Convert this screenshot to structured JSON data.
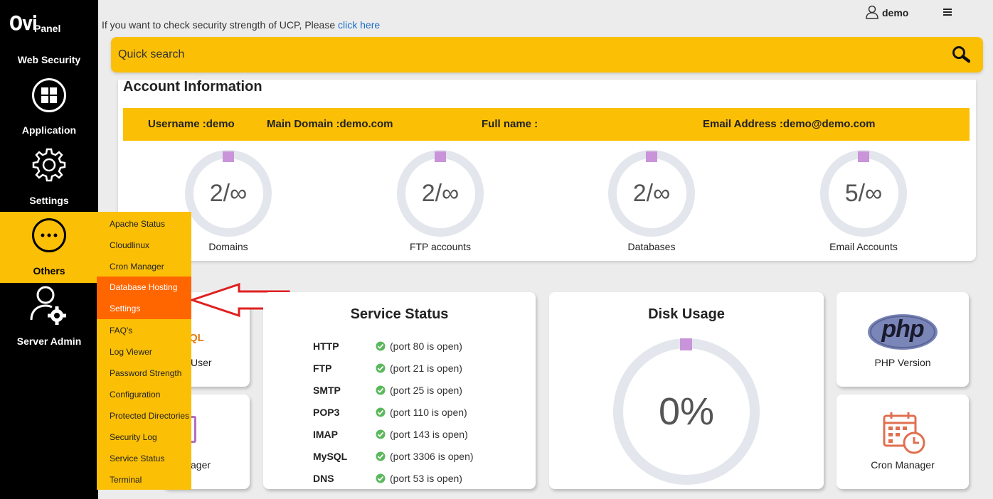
{
  "brand": {
    "logo_big": "Ovi",
    "logo_small": "Panel"
  },
  "sidebar": {
    "items": [
      {
        "label": "Web Security",
        "icon": "shield-icon"
      },
      {
        "label": "Application",
        "icon": "grid-icon"
      },
      {
        "label": "Settings",
        "icon": "gear-icon"
      },
      {
        "label": "Others",
        "icon": "more-icon"
      },
      {
        "label": "Server Admin",
        "icon": "user-gear-icon"
      }
    ]
  },
  "others_menu": {
    "items": [
      "Apache Status",
      "Cloudlinux",
      "Cron Manager",
      "Database Hosting",
      "Settings",
      "FAQ's",
      "Log Viewer",
      "Password Strength",
      "Configuration",
      "Protected Directories",
      "Security Log",
      "Service Status",
      "Terminal"
    ],
    "highlighted": [
      "Database Hosting",
      "Settings"
    ]
  },
  "header": {
    "message": "If you want to check security strength of UCP, Please ",
    "message_link": "click here",
    "username": "demo",
    "menu_icon": "hamburger-icon"
  },
  "search": {
    "placeholder": "Quick search",
    "icon": "search-icon"
  },
  "account": {
    "title": "Account Information",
    "username": "Username :demo",
    "main_domain": "Main Domain :demo.com",
    "full_name": "Full name :",
    "email": "Email Address :demo@demo.com",
    "stats": [
      {
        "value": "2/∞",
        "label": "Domains"
      },
      {
        "value": "2/∞",
        "label": "FTP accounts"
      },
      {
        "value": "2/∞",
        "label": "Databases"
      },
      {
        "value": "5/∞",
        "label": "Email Accounts"
      }
    ]
  },
  "service_status": {
    "title": "Service Status",
    "services": [
      {
        "name": "HTTP",
        "status": "(port 80 is open)"
      },
      {
        "name": "FTP",
        "status": "(port 21 is open)"
      },
      {
        "name": "SMTP",
        "status": "(port 25 is open)"
      },
      {
        "name": "POP3",
        "status": "(port 110 is open)"
      },
      {
        "name": "IMAP",
        "status": "(port 143 is open)"
      },
      {
        "name": "MySQL",
        "status": "(port 3306 is open)"
      },
      {
        "name": "DNS",
        "status": "(port 53 is open)"
      }
    ]
  },
  "disk_usage": {
    "title": "Disk Usage",
    "value": "0%",
    "fraction": 0
  },
  "tiles": {
    "mysql_user_partial": "User",
    "mysql_logo_partial": "QL",
    "manager_partial": "ager",
    "php_logo": "php",
    "php_version": "PHP Version",
    "cron_manager": "Cron Manager"
  },
  "colors": {
    "accent": "#fbbf06",
    "active": "#ff6600",
    "sidebar": "#000000",
    "donut_track": "#e3e6ec",
    "donut_marker": "#c994d9",
    "arrow": "#e02020",
    "ok": "#5cb85c"
  }
}
